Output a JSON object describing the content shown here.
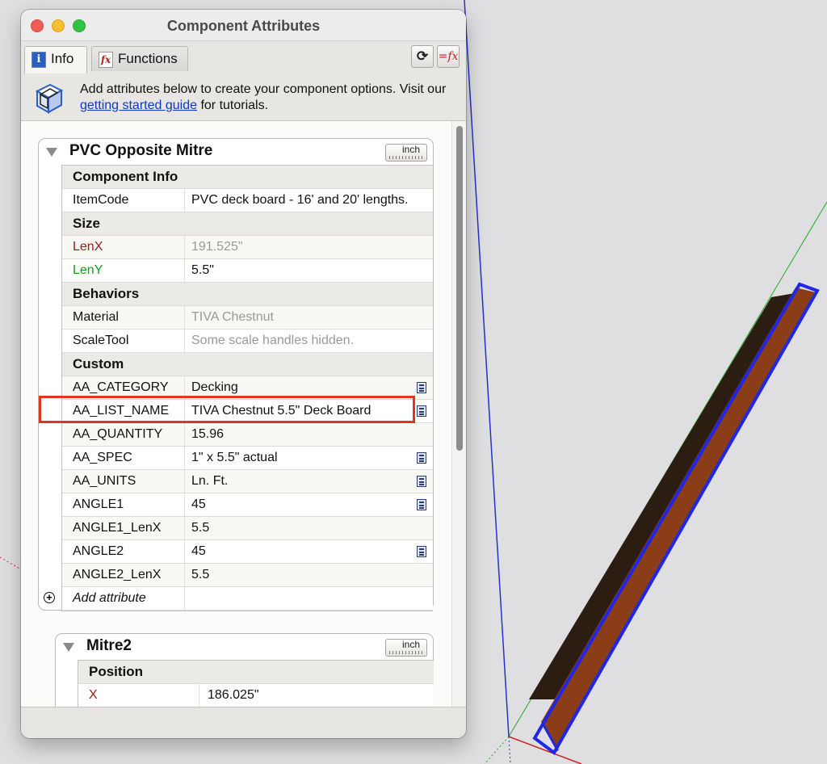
{
  "window": {
    "title": "Component Attributes"
  },
  "tabs": [
    {
      "label": "Info"
    },
    {
      "label": "Functions"
    }
  ],
  "toolbar": {
    "refresh_label": "⟳",
    "fx_label": "=fx"
  },
  "banner": {
    "text_before": "Add attributes below to create your component options. Visit our ",
    "link": "getting started guide",
    "text_after": " for tutorials."
  },
  "components": [
    {
      "name": "PVC Opposite Mitre",
      "units": "inch",
      "sections": [
        {
          "title": "Component Info",
          "rows": [
            {
              "name": "ItemCode",
              "value": "PVC deck board - 16' and 20' lengths."
            }
          ]
        },
        {
          "title": "Size",
          "rows": [
            {
              "name": "LenX",
              "value": "191.525\""
            },
            {
              "name": "LenY",
              "value": "5.5\""
            }
          ]
        },
        {
          "title": "Behaviors",
          "rows": [
            {
              "name": "Material",
              "value": "TIVA Chestnut"
            },
            {
              "name": "ScaleTool",
              "value": "Some scale handles hidden."
            }
          ]
        },
        {
          "title": "Custom",
          "rows": [
            {
              "name": "AA_CATEGORY",
              "value": "Decking"
            },
            {
              "name": "AA_LIST_NAME",
              "value": "TIVA Chestnut 5.5\" Deck Board"
            },
            {
              "name": "AA_QUANTITY",
              "value": "15.96"
            },
            {
              "name": "AA_SPEC",
              "value": "1\" x 5.5\" actual"
            },
            {
              "name": "AA_UNITS",
              "value": "Ln. Ft."
            },
            {
              "name": "ANGLE1",
              "value": "45"
            },
            {
              "name": "ANGLE1_LenX",
              "value": "5.5"
            },
            {
              "name": "ANGLE2",
              "value": "45"
            },
            {
              "name": "ANGLE2_LenX",
              "value": "5.5"
            }
          ]
        }
      ],
      "add_attribute": "Add attribute"
    },
    {
      "name": "Mitre2",
      "units": "inch",
      "sections": [
        {
          "title": "Position",
          "rows": [
            {
              "name": "X",
              "value": "186.025\""
            }
          ]
        }
      ]
    }
  ],
  "colors": {
    "axis_blue": "#2233cc",
    "axis_green": "#22aa22",
    "axis_red": "#cc2222",
    "board_wood": "#8a3d16",
    "board_dark": "#2b1d12",
    "selection": "#1e27e6",
    "highlight_box": "#e1361f"
  }
}
